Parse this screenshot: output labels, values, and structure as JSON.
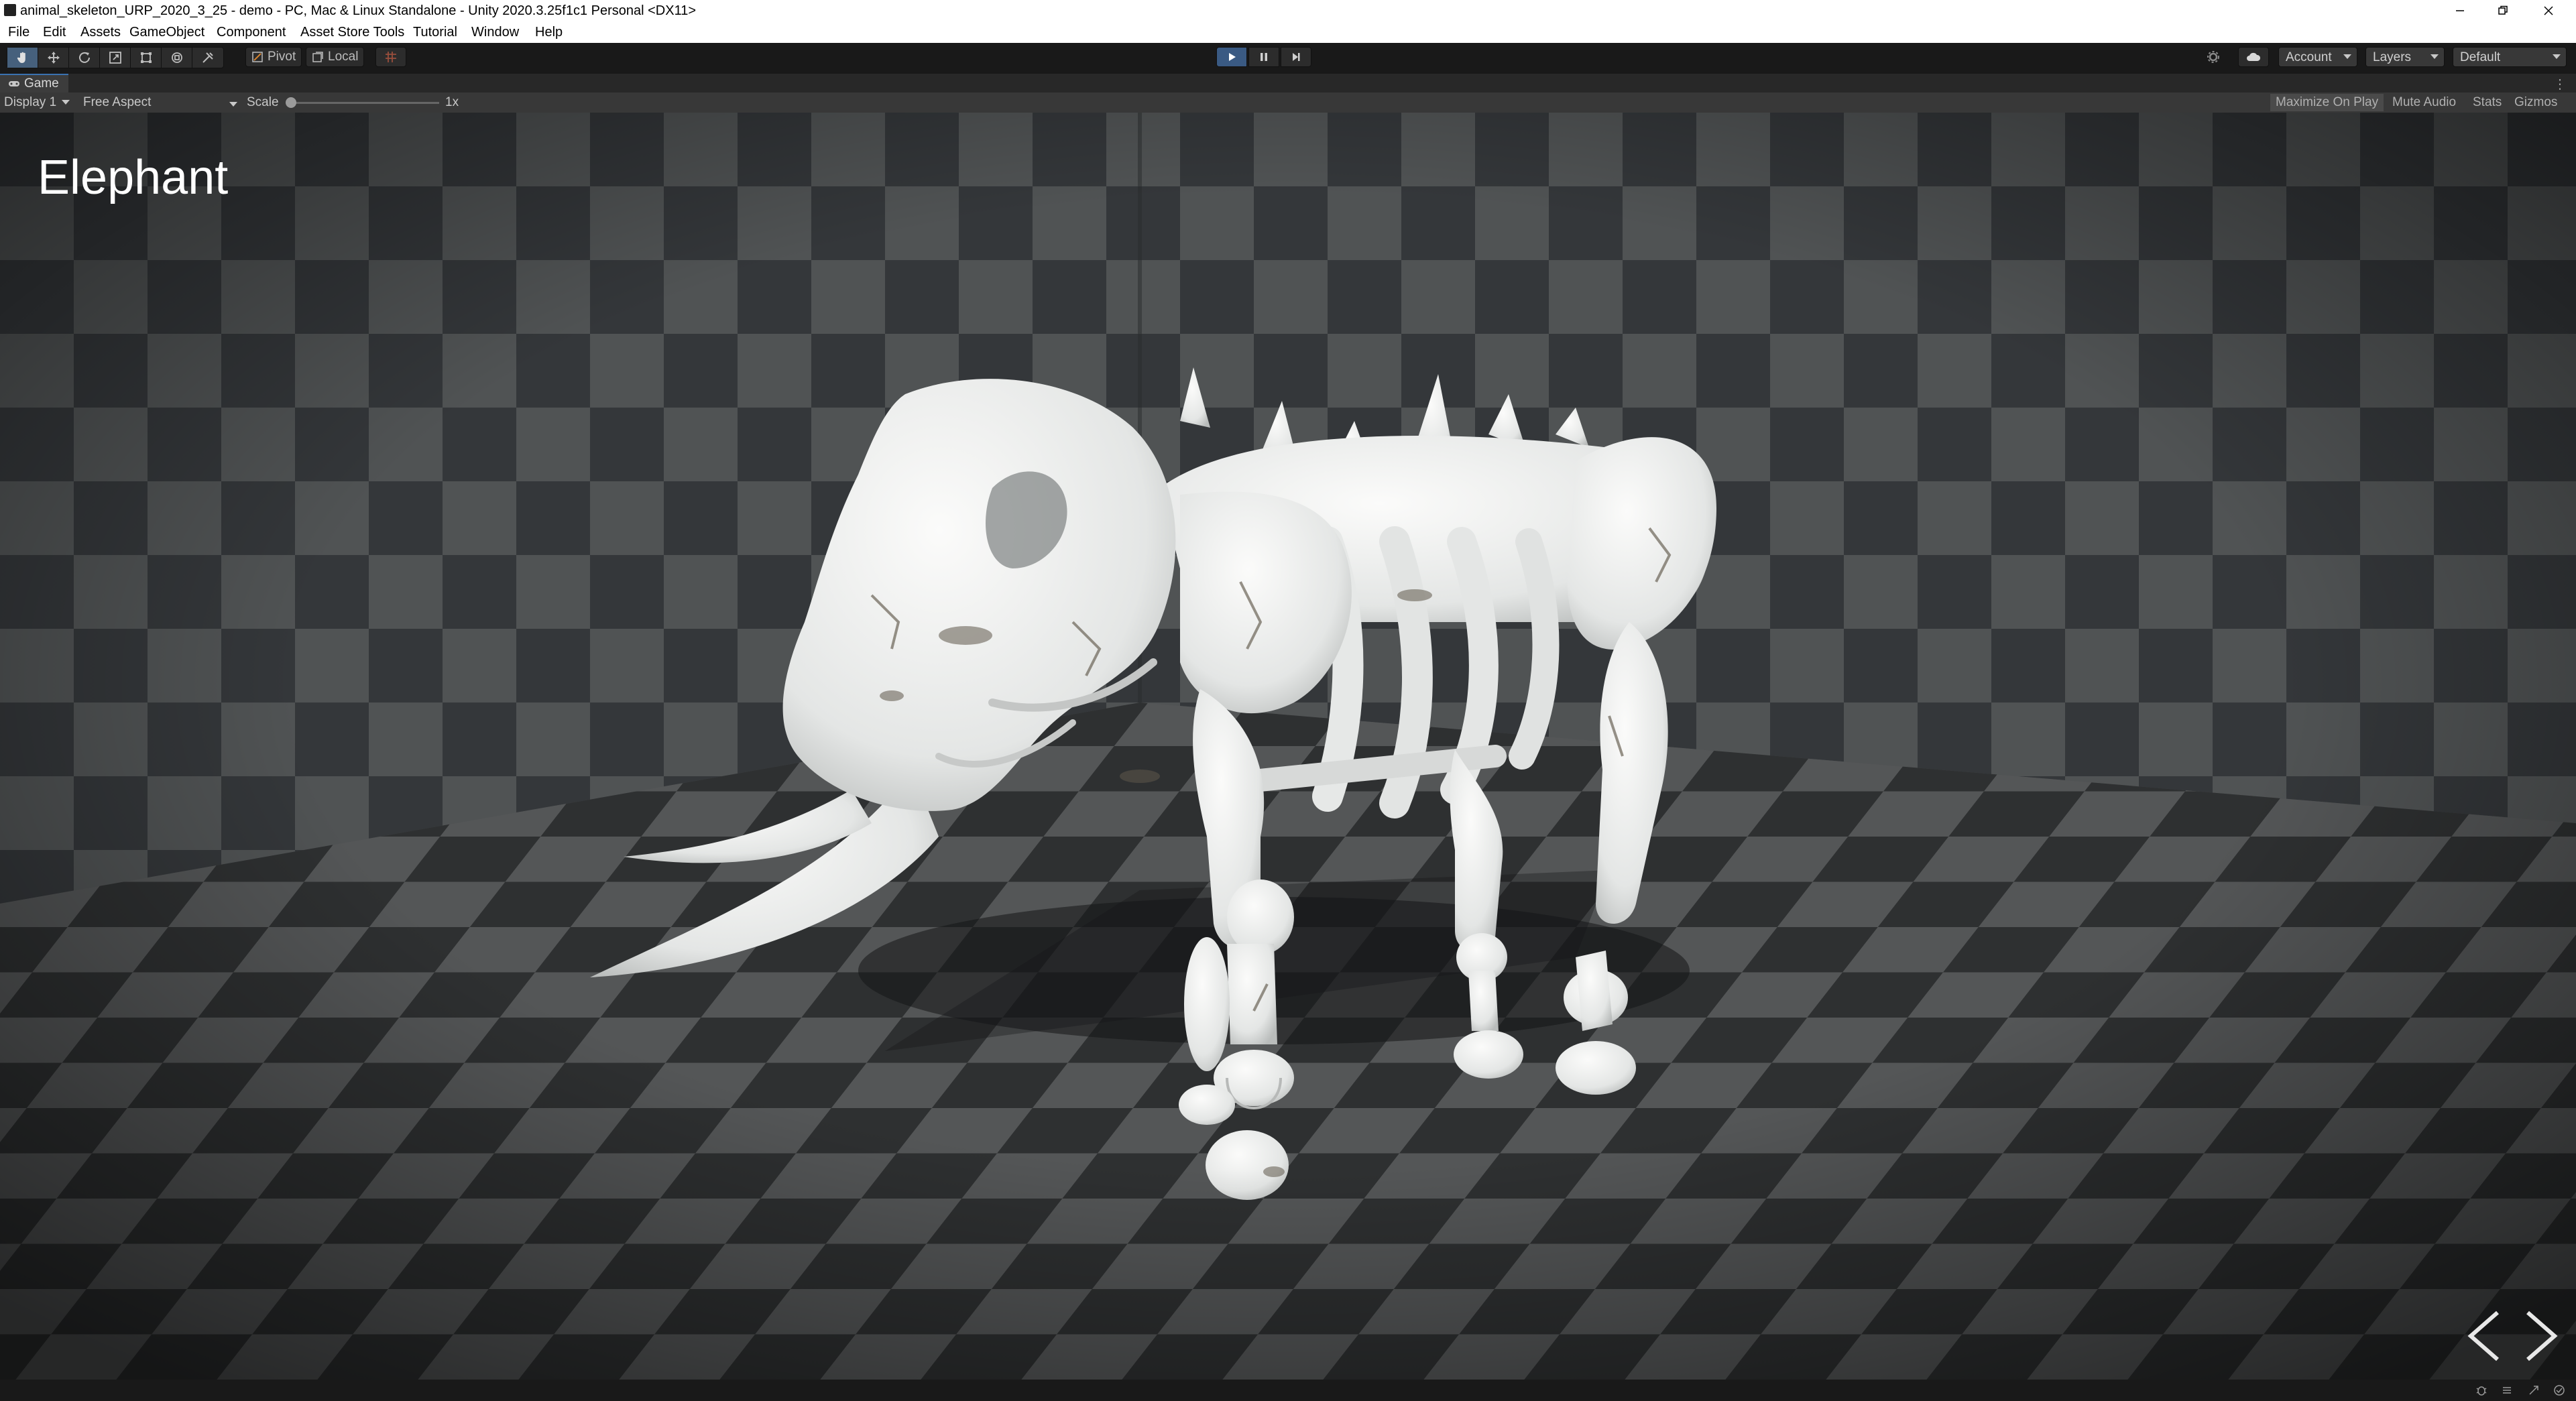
{
  "window": {
    "title": "animal_skeleton_URP_2020_3_25 - demo - PC, Mac & Linux Standalone - Unity 2020.3.25f1c1 Personal <DX11>"
  },
  "menu": [
    "File",
    "Edit",
    "Assets",
    "GameObject",
    "Component",
    "Asset Store Tools",
    "Tutorial",
    "Window",
    "Help"
  ],
  "toolbar": {
    "tools": [
      "hand-tool",
      "move-tool",
      "rotate-tool",
      "scale-tool",
      "rect-tool",
      "transform-tool",
      "custom-tool"
    ],
    "active_tool": "hand-tool",
    "pivot_label": "Pivot",
    "local_label": "Local",
    "play_state": "playing",
    "account_label": "Account",
    "layers_label": "Layers",
    "layout_label": "Default"
  },
  "game_view": {
    "tab_label": "Game",
    "display_label": "Display 1",
    "aspect_label": "Free Aspect",
    "scale_label": "Scale",
    "scale_value": "1x",
    "maximize_label": "Maximize On Play",
    "mute_label": "Mute Audio",
    "stats_label": "Stats",
    "gizmos_label": "Gizmos"
  },
  "scene": {
    "title": "Elephant"
  },
  "colors": {
    "accent": "#3a72b0",
    "play_active": "#3a5a83",
    "bone": "#e9ebea",
    "floor_dark": "#2d2f30",
    "floor_light": "#4a4c4d"
  }
}
